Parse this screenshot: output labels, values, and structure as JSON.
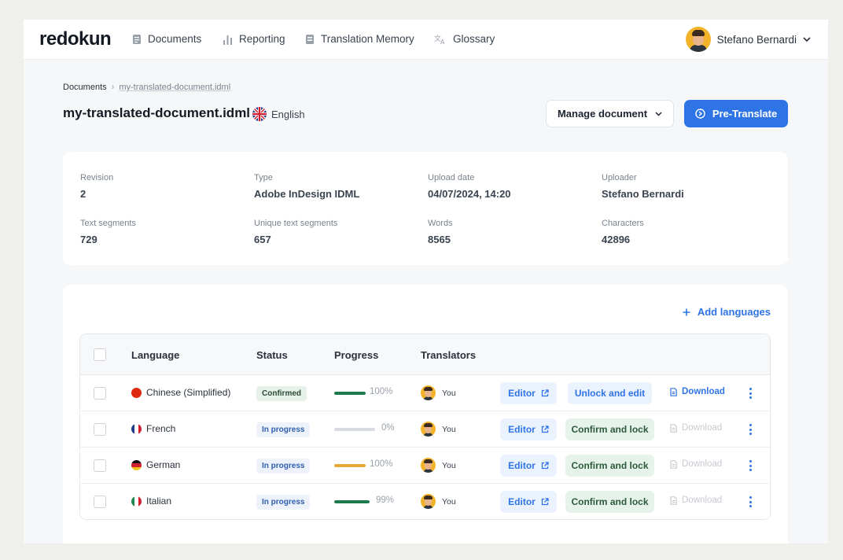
{
  "app": {
    "logo": "redokun"
  },
  "nav": [
    {
      "label": "Documents",
      "icon": "document-icon"
    },
    {
      "label": "Reporting",
      "icon": "bar-chart-icon"
    },
    {
      "label": "Translation Memory",
      "icon": "memory-icon"
    },
    {
      "label": "Glossary",
      "icon": "translate-icon"
    }
  ],
  "user": {
    "name": "Stefano Bernardi"
  },
  "breadcrumb": {
    "root": "Documents",
    "separator": "›",
    "current": "my-translated-document.idml"
  },
  "document": {
    "title": "my-translated-document.idml",
    "source_language": "English",
    "manage_label": "Manage document",
    "pretranslate_label": "Pre-Translate"
  },
  "info": {
    "revision": {
      "label": "Revision",
      "value": "2"
    },
    "type": {
      "label": "Type",
      "value": "Adobe InDesign IDML"
    },
    "upload_date": {
      "label": "Upload date",
      "value": "04/07/2024, 14:20"
    },
    "uploader": {
      "label": "Uploader",
      "value": "Stefano Bernardi"
    },
    "text_segments": {
      "label": "Text segments",
      "value": "729"
    },
    "unique_segments": {
      "label": "Unique text segments",
      "value": "657"
    },
    "words": {
      "label": "Words",
      "value": "8565"
    },
    "characters": {
      "label": "Characters",
      "value": "42896"
    }
  },
  "languages": {
    "add_label": "Add languages",
    "columns": {
      "language": "Language",
      "status": "Status",
      "progress": "Progress",
      "translators": "Translators"
    },
    "rows": [
      {
        "language": "Chinese (Simplified)",
        "status": "Confirmed",
        "status_kind": "confirmed",
        "progress": 1.0,
        "progress_text": "100%",
        "progress_color": "#1e7a4c",
        "translator": "You",
        "editor_label": "Editor",
        "action_label": "Unlock and edit",
        "action_kind": "unlock",
        "download_label": "Download",
        "download_enabled": true
      },
      {
        "language": "French",
        "status": "In progress",
        "status_kind": "progress",
        "progress": 0.0,
        "progress_text": "0%",
        "progress_color": "#1e7a4c",
        "translator": "You",
        "editor_label": "Editor",
        "action_label": "Confirm and lock",
        "action_kind": "confirm",
        "download_label": "Download",
        "download_enabled": false
      },
      {
        "language": "German",
        "status": "In progress",
        "status_kind": "progress",
        "progress": 1.0,
        "progress_text": "100%",
        "progress_color": "#e8a935",
        "translator": "You",
        "editor_label": "Editor",
        "action_label": "Confirm and lock",
        "action_kind": "confirm",
        "download_label": "Download",
        "download_enabled": false
      },
      {
        "language": "Italian",
        "status": "In progress",
        "status_kind": "progress",
        "progress": 0.99,
        "progress_text": "99%",
        "progress_color": "#1e7a4c",
        "translator": "You",
        "editor_label": "Editor",
        "action_label": "Confirm and lock",
        "action_kind": "confirm",
        "download_label": "Download",
        "download_enabled": false
      }
    ]
  },
  "colors": {
    "accent": "#2f74e6",
    "confirmed_green": "#1e7a4c",
    "german_bar": "#e8a935"
  }
}
